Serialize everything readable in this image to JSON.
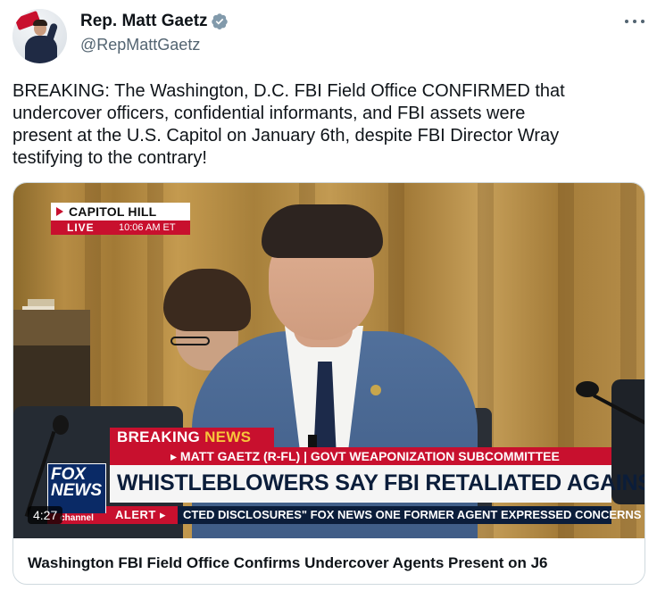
{
  "author": {
    "name": "Rep. Matt Gaetz",
    "handle": "@RepMattGaetz",
    "verified_icon": "verified-badge-icon",
    "verified_color": "#829aab"
  },
  "tweet": {
    "text_lines": [
      "BREAKING: The Washington, D.C. FBI Field Office CONFIRMED that",
      "undercover officers, confidential informants, and FBI assets were",
      "present at the U.S. Capitol on January 6th, despite FBI Director Wray",
      "testifying to the contrary!"
    ],
    "more_icon": "more-horizontal-icon"
  },
  "video": {
    "duration": "4:27",
    "overlay": {
      "location": "CAPITOL HILL",
      "live": "LIVE",
      "time": "10:06 AM ET",
      "breaking_1": "BREAKING",
      "breaking_2": "NEWS",
      "subtitle": "▸ MATT GAETZ (R-FL) | GOVT WEAPONIZATION SUBCOMMITTEE",
      "headline": "WHISTLEBLOWERS SAY FBI RETALIATED AGAINST THEM",
      "alert": "ALERT ▸",
      "ticker": "CTED DISCLOSURES\"  FOX NEWS  ONE FORMER AGENT EXPRESSED CONCERNS",
      "network_line1": "FOX",
      "network_line2": "NEWS",
      "network_line3": "channel"
    }
  },
  "card": {
    "title": "Washington FBI Field Office Confirms Undercover Agents Present on J6"
  },
  "colors": {
    "text": "#0f1419",
    "secondary": "#536471",
    "fox_red": "#c8102e",
    "fox_navy": "#0b1d3a"
  }
}
